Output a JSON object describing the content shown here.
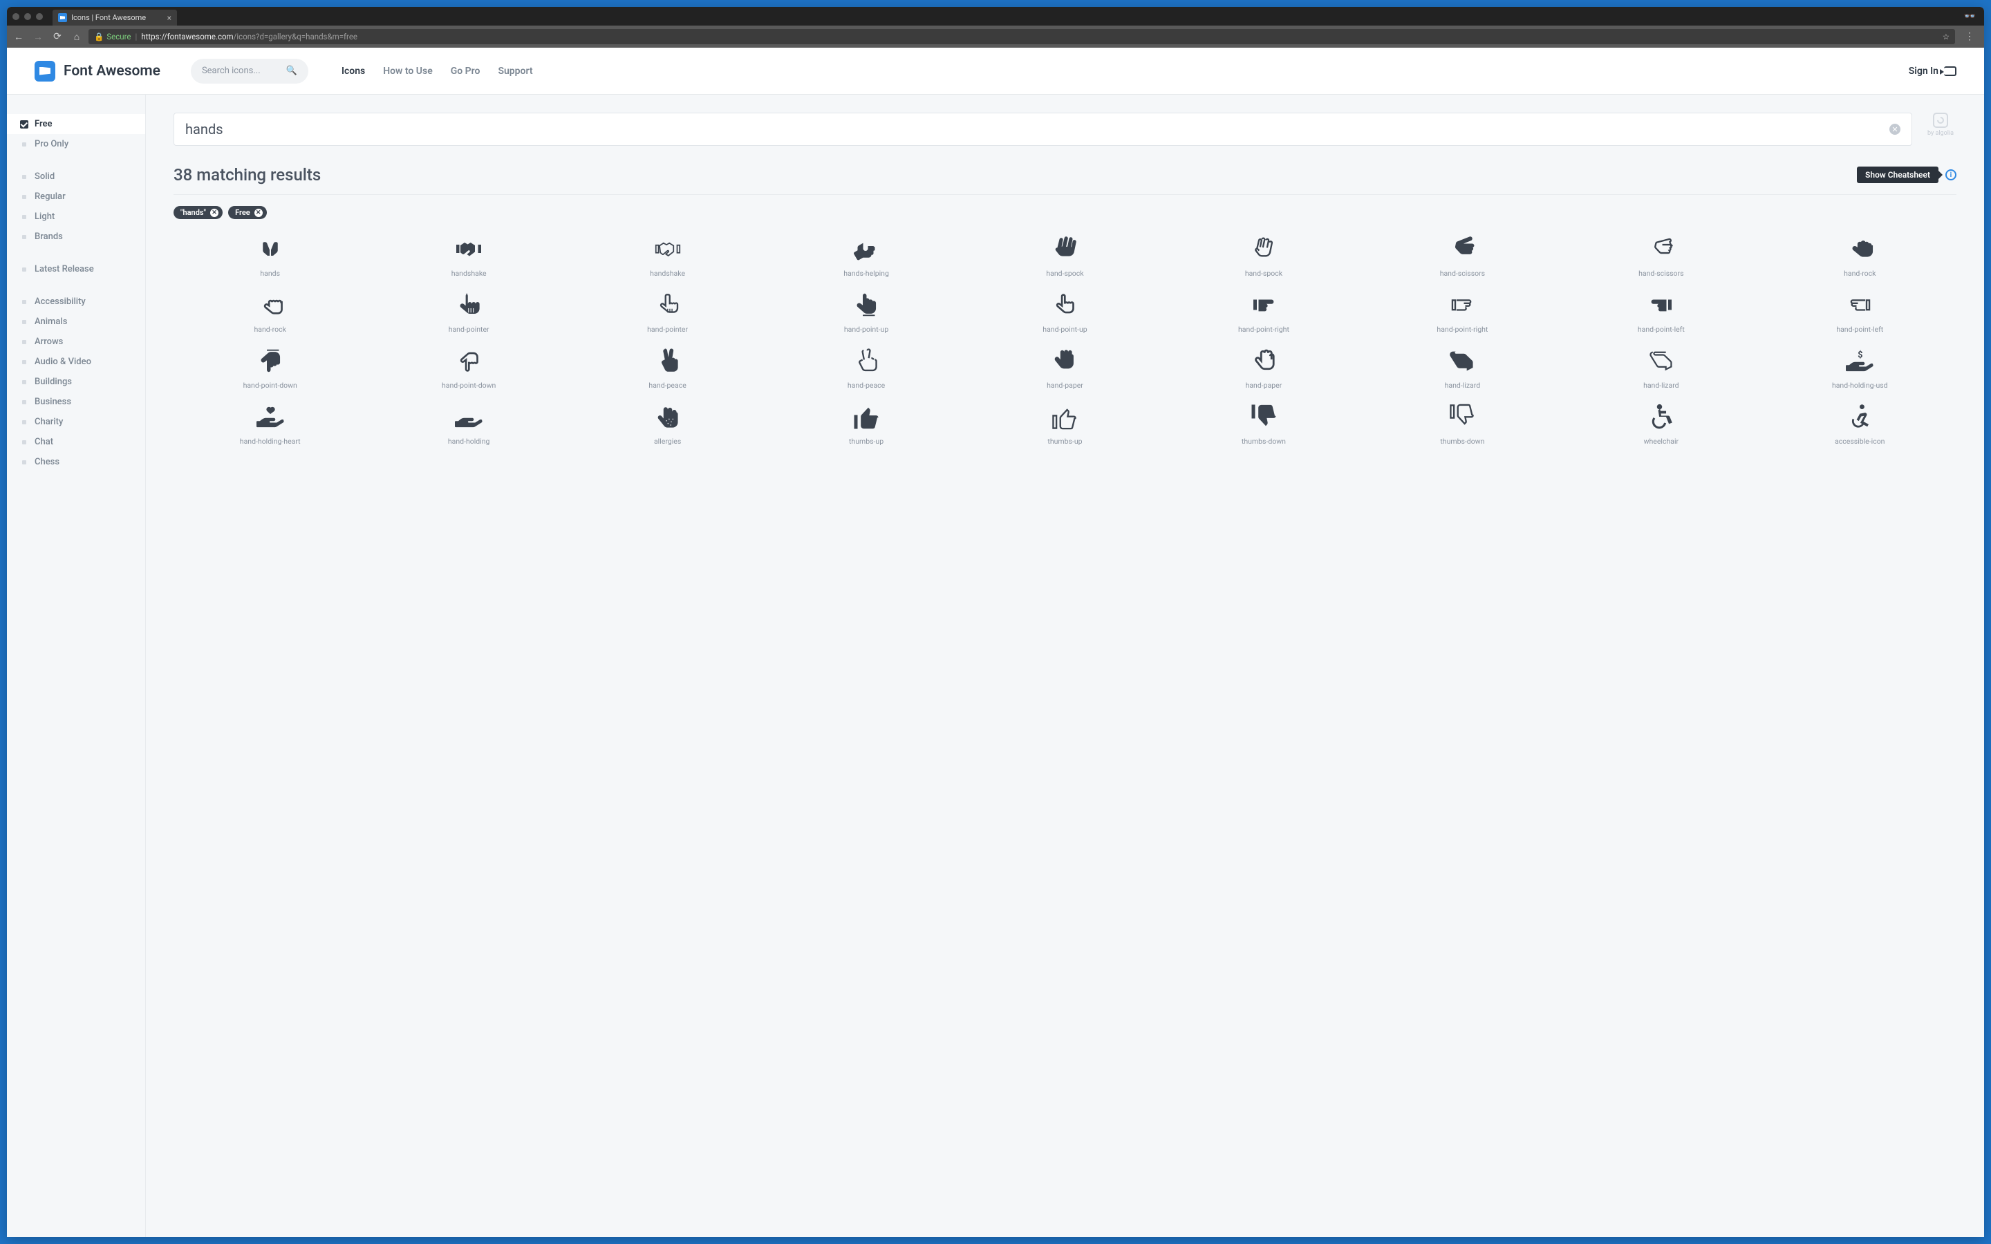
{
  "browser": {
    "tab_title": "Icons | Font Awesome",
    "secure_label": "Secure",
    "url_host": "https://fontawesome.com",
    "url_path": "/icons?d=gallery&q=hands&m=free"
  },
  "header": {
    "logo_text": "Font Awesome",
    "search_placeholder": "Search icons...",
    "nav": [
      "Icons",
      "How to Use",
      "Go Pro",
      "Support"
    ],
    "signin": "Sign In"
  },
  "sidebar": {
    "tiers": [
      {
        "label": "Free",
        "checked": true
      },
      {
        "label": "Pro Only",
        "checked": false
      }
    ],
    "styles": [
      "Solid",
      "Regular",
      "Light",
      "Brands"
    ],
    "latest": "Latest Release",
    "categories": [
      "Accessibility",
      "Animals",
      "Arrows",
      "Audio & Video",
      "Buildings",
      "Business",
      "Charity",
      "Chat",
      "Chess"
    ]
  },
  "search": {
    "query": "hands",
    "algolia": "by algolia",
    "results_label": "38 matching results",
    "cheatsheet": "Show Cheatsheet",
    "chips": [
      "\"hands\"",
      "Free"
    ]
  },
  "icons": [
    "hands",
    "handshake",
    "handshake",
    "hands-helping",
    "hand-spock",
    "hand-spock",
    "hand-scissors",
    "hand-scissors",
    "hand-rock",
    "hand-rock",
    "hand-pointer",
    "hand-pointer",
    "hand-point-up",
    "hand-point-up",
    "hand-point-right",
    "hand-point-right",
    "hand-point-left",
    "hand-point-left",
    "hand-point-down",
    "hand-point-down",
    "hand-peace",
    "hand-peace",
    "hand-paper",
    "hand-paper",
    "hand-lizard",
    "hand-lizard",
    "hand-holding-usd",
    "hand-holding-heart",
    "hand-holding",
    "allergies",
    "thumbs-up",
    "thumbs-up",
    "thumbs-down",
    "thumbs-down",
    "wheelchair",
    "accessible-icon"
  ]
}
